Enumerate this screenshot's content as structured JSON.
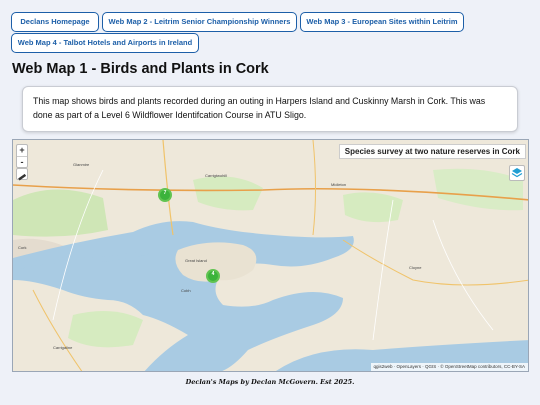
{
  "nav": {
    "items": [
      {
        "label": "Declans Homepage"
      },
      {
        "label": "Web Map 2 - Leitrim Senior Championship Winners"
      },
      {
        "label": "Web Map 3 - European Sites within Leitrim"
      },
      {
        "label": "Web Map 4 - Talbot Hotels and Airports in Ireland"
      }
    ]
  },
  "page": {
    "title": "Web Map 1 - Birds and Plants in Cork",
    "description": "This map shows birds and plants recorded during an outing in Harpers Island and Cuskinny Marsh in Cork. This was done as part of a Level 6 Wildflower Identifcation Course in ATU Sligo."
  },
  "map": {
    "title": "Species survey at two nature reserves in Cork",
    "zoom_in": "+",
    "zoom_out": "-",
    "clusters": [
      {
        "count": "7"
      },
      {
        "count": "4"
      }
    ],
    "attribution": "qgis2web · OpenLayers · QGIS · © OpenStreetMap contributors, CC-BY-SA",
    "labels": {
      "glanmire": "Glanmire",
      "carrigtwohill": "Carrigtwohill",
      "midleton": "Midleton",
      "great_island": "Great Island",
      "cobh": "Cobh",
      "cloyne": "Cloyne",
      "cork": "Cork",
      "carrigaline": "Carrigaline"
    }
  },
  "footer": {
    "text": "Declan's Maps by Declan McGovern. Est 2025."
  }
}
